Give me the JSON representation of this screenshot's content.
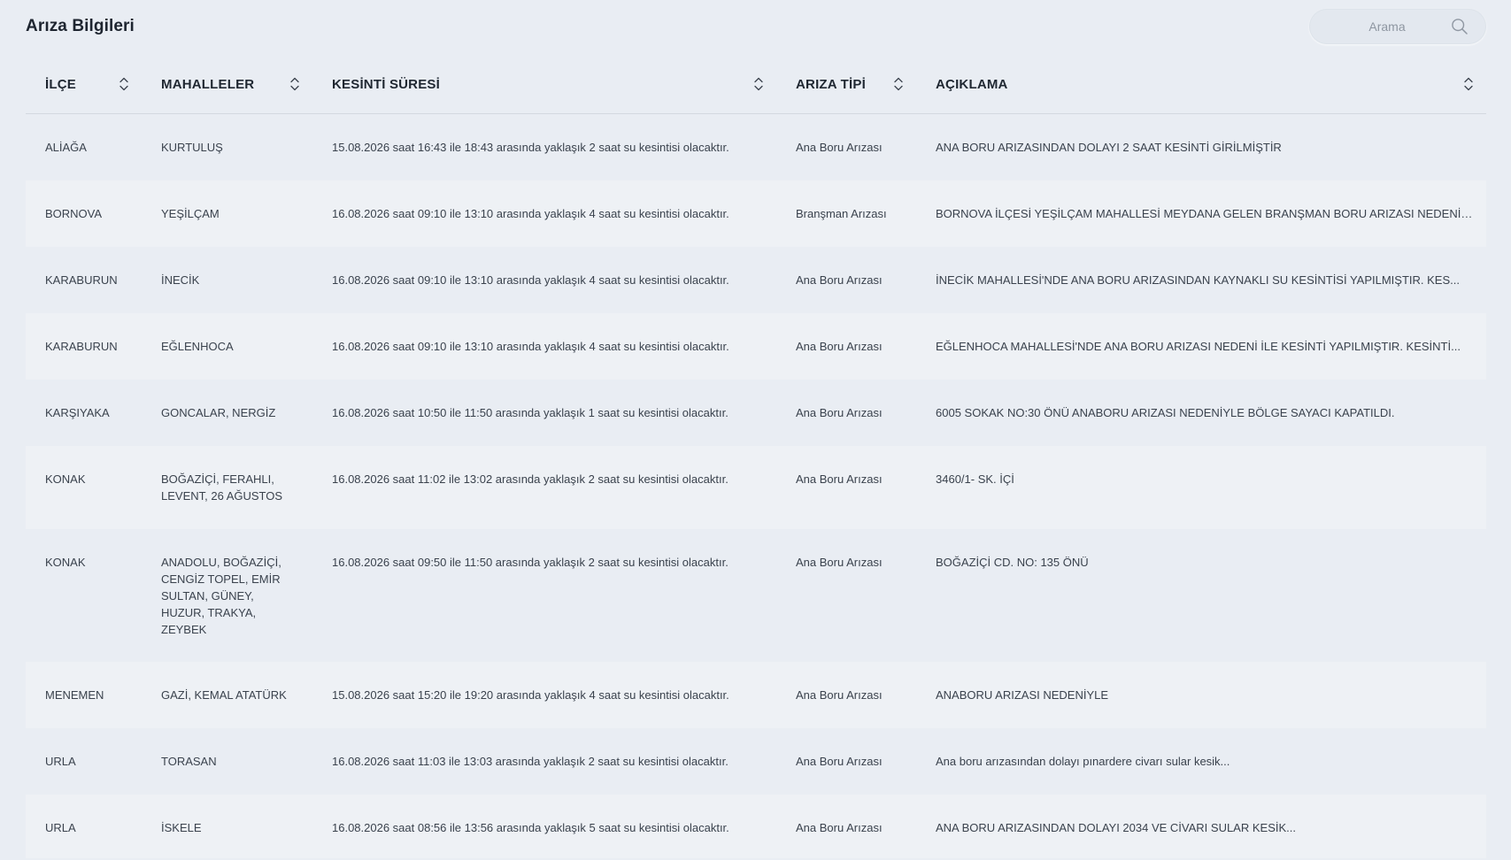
{
  "header": {
    "title": "Arıza Bilgileri",
    "search_placeholder": "Arama"
  },
  "table": {
    "columns": [
      {
        "key": "ilce",
        "label": "İLÇE"
      },
      {
        "key": "mahalleler",
        "label": "MAHALLELER"
      },
      {
        "key": "kesinti",
        "label": "KESİNTİ SÜRESİ"
      },
      {
        "key": "tip",
        "label": "ARIZA TİPİ"
      },
      {
        "key": "aciklama",
        "label": "AÇIKLAMA"
      }
    ],
    "rows": [
      {
        "ilce": "ALİAĞA",
        "mahalleler": "KURTULUŞ",
        "kesinti": "15.08.2026 saat 16:43 ile 18:43 arasında yaklaşık 2 saat su kesintisi olacaktır.",
        "tip": "Ana Boru Arızası",
        "aciklama": "ANA BORU ARIZASINDAN DOLAYI 2 SAAT KESİNTİ GİRİLMİŞTİR"
      },
      {
        "ilce": "BORNOVA",
        "mahalleler": "YEŞİLÇAM",
        "kesinti": "16.08.2026 saat 09:10 ile 13:10 arasında yaklaşık 4 saat su kesintisi olacaktır.",
        "tip": "Branşman Arızası",
        "aciklama": "BORNOVA İLÇESİ YEŞİLÇAM MAHALLESİ MEYDANA GELEN BRANŞMAN BORU ARIZASI NEDENİYLE ..."
      },
      {
        "ilce": "KARABURUN",
        "mahalleler": "İNECİK",
        "kesinti": "16.08.2026 saat 09:10 ile 13:10 arasında yaklaşık 4 saat su kesintisi olacaktır.",
        "tip": "Ana Boru Arızası",
        "aciklama": "İNECİK MAHALLESİ'NDE ANA BORU ARIZASINDAN KAYNAKLI SU KESİNTİSİ YAPILMIŞTIR. KES..."
      },
      {
        "ilce": "KARABURUN",
        "mahalleler": "EĞLENHOCA",
        "kesinti": "16.08.2026 saat 09:10 ile 13:10 arasında yaklaşık 4 saat su kesintisi olacaktır.",
        "tip": "Ana Boru Arızası",
        "aciklama": "EĞLENHOCA MAHALLESİ'NDE ANA BORU ARIZASI NEDENİ İLE KESİNTİ YAPILMIŞTIR. KESİNTİ..."
      },
      {
        "ilce": "KARŞIYAKA",
        "mahalleler": "GONCALAR, NERGİZ",
        "kesinti": "16.08.2026 saat 10:50 ile 11:50 arasında yaklaşık 1 saat su kesintisi olacaktır.",
        "tip": "Ana Boru Arızası",
        "aciklama": "6005 SOKAK NO:30 ÖNÜ ANABORU ARIZASI NEDENİYLE BÖLGE SAYACI KAPATILDI."
      },
      {
        "ilce": "KONAK",
        "mahalleler": "BOĞAZİÇİ, FERAHLI, LEVENT, 26 AĞUSTOS",
        "kesinti": "16.08.2026 saat 11:02 ile 13:02 arasında yaklaşık 2 saat su kesintisi olacaktır.",
        "tip": "Ana Boru Arızası",
        "aciklama": "3460/1- SK. İÇİ"
      },
      {
        "ilce": "KONAK",
        "mahalleler": "ANADOLU, BOĞAZİÇİ, CENGİZ TOPEL, EMİR SULTAN, GÜNEY, HUZUR, TRAKYA, ZEYBEK",
        "kesinti": "16.08.2026 saat 09:50 ile 11:50 arasında yaklaşık 2 saat su kesintisi olacaktır.",
        "tip": "Ana Boru Arızası",
        "aciklama": "BOĞAZİÇİ CD. NO: 135 ÖNÜ"
      },
      {
        "ilce": "MENEMEN",
        "mahalleler": "GAZİ, KEMAL ATATÜRK",
        "kesinti": "15.08.2026 saat 15:20 ile 19:20 arasında yaklaşık 4 saat su kesintisi olacaktır.",
        "tip": "Ana Boru Arızası",
        "aciklama": "ANABORU ARIZASI NEDENİYLE"
      },
      {
        "ilce": "URLA",
        "mahalleler": "TORASAN",
        "kesinti": "16.08.2026 saat 11:03 ile 13:03 arasında yaklaşık 2 saat su kesintisi olacaktır.",
        "tip": "Ana Boru Arızası",
        "aciklama": "Ana boru arızasından dolayı pınardere civarı sular kesik..."
      },
      {
        "ilce": "URLA",
        "mahalleler": "İSKELE",
        "kesinti": "16.08.2026 saat 08:56 ile 13:56 arasında yaklaşık 5 saat su kesintisi olacaktır.",
        "tip": "Ana Boru Arızası",
        "aciklama": "ANA BORU ARIZASINDAN DOLAYI 2034 VE CİVARI SULAR KESİK..."
      }
    ]
  },
  "colors": {
    "background": "#e9edf3",
    "row_alt": "#eef1f5",
    "text": "#3a424d",
    "header_text": "#1f2731"
  },
  "icons": {
    "search": "search-icon",
    "sort": "sort-icon"
  }
}
